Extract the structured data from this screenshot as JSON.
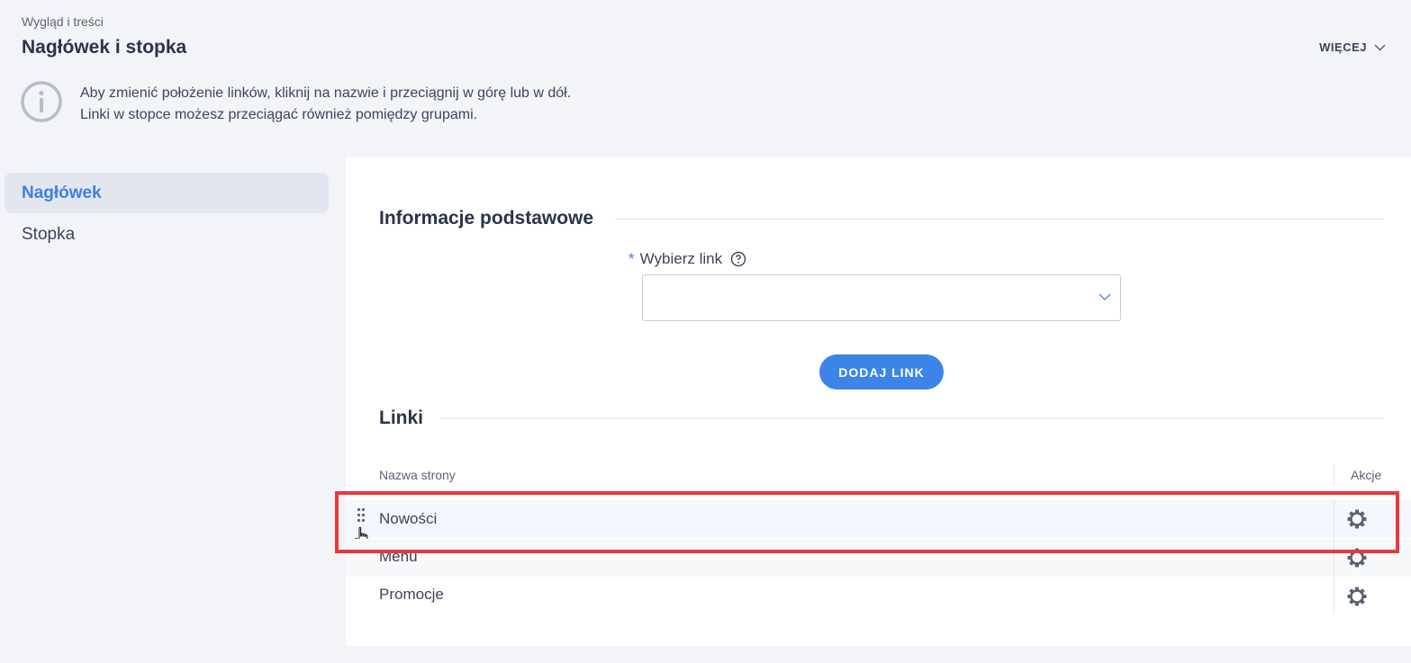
{
  "header": {
    "breadcrumb": "Wygląd i treści",
    "title": "Nagłówek i stopka",
    "more_label": "WIĘCEJ",
    "info_line1": "Aby zmienić położenie linków, kliknij na nazwie i przeciągnij w górę lub w dół.",
    "info_line2": "Linki w stopce możesz przeciągać również pomiędzy grupami."
  },
  "sidebar": {
    "items": [
      {
        "label": "Nagłówek",
        "active": true
      },
      {
        "label": "Stopka",
        "active": false
      }
    ]
  },
  "main": {
    "section_basic": "Informacje podstawowe",
    "field_required_marker": "*",
    "field_label": "Wybierz link",
    "select_value": "",
    "add_button": "DODAJ LINK",
    "section_links": "Linki",
    "table": {
      "col_name": "Nazwa strony",
      "col_actions": "Akcje",
      "rows": [
        {
          "name": "Nowości"
        },
        {
          "name": "Menu"
        },
        {
          "name": "Promocje"
        }
      ]
    }
  },
  "colors": {
    "accent": "#3d84e8",
    "active_nav_text": "#3d7fe0",
    "highlight_border": "#e8383e"
  },
  "icons": {
    "info": "info-circle-icon",
    "help": "question-circle-icon",
    "chevron": "chevron-down-icon",
    "gear": "gear-icon",
    "drag": "drag-handle-icon",
    "cursor": "hand-pointer-icon"
  }
}
